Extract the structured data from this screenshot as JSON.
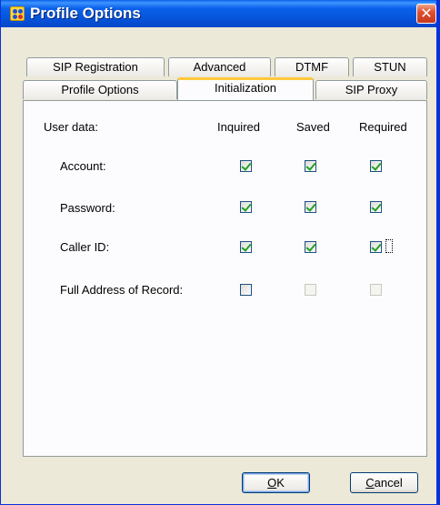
{
  "window": {
    "title": "Profile Options",
    "close_glyph": "✕"
  },
  "tabs": {
    "row1": [
      "SIP Registration",
      "Advanced",
      "DTMF",
      "STUN"
    ],
    "row2": [
      "Profile Options",
      "Initialization",
      "SIP Proxy"
    ],
    "active": "Initialization"
  },
  "panel": {
    "section_label": "User data:",
    "columns": [
      "Inquired",
      "Saved",
      "Required"
    ],
    "rows": [
      {
        "label": "Account:",
        "inquired": true,
        "saved": true,
        "required": true
      },
      {
        "label": "Password:",
        "inquired": true,
        "saved": true,
        "required": true
      },
      {
        "label": "Caller ID:",
        "inquired": true,
        "saved": true,
        "required": true
      },
      {
        "label": "Full Address of Record:",
        "inquired": false,
        "saved": false,
        "required": false,
        "saved_disabled": true,
        "required_disabled": true
      }
    ]
  },
  "buttons": {
    "ok": {
      "mnemonic": "O",
      "rest": "K"
    },
    "cancel": {
      "mnemonic": "C",
      "rest": "ancel"
    }
  },
  "colors": {
    "titlebar": "#0653d9",
    "accent_tab": "#ffc83c",
    "check": "#21a121"
  }
}
